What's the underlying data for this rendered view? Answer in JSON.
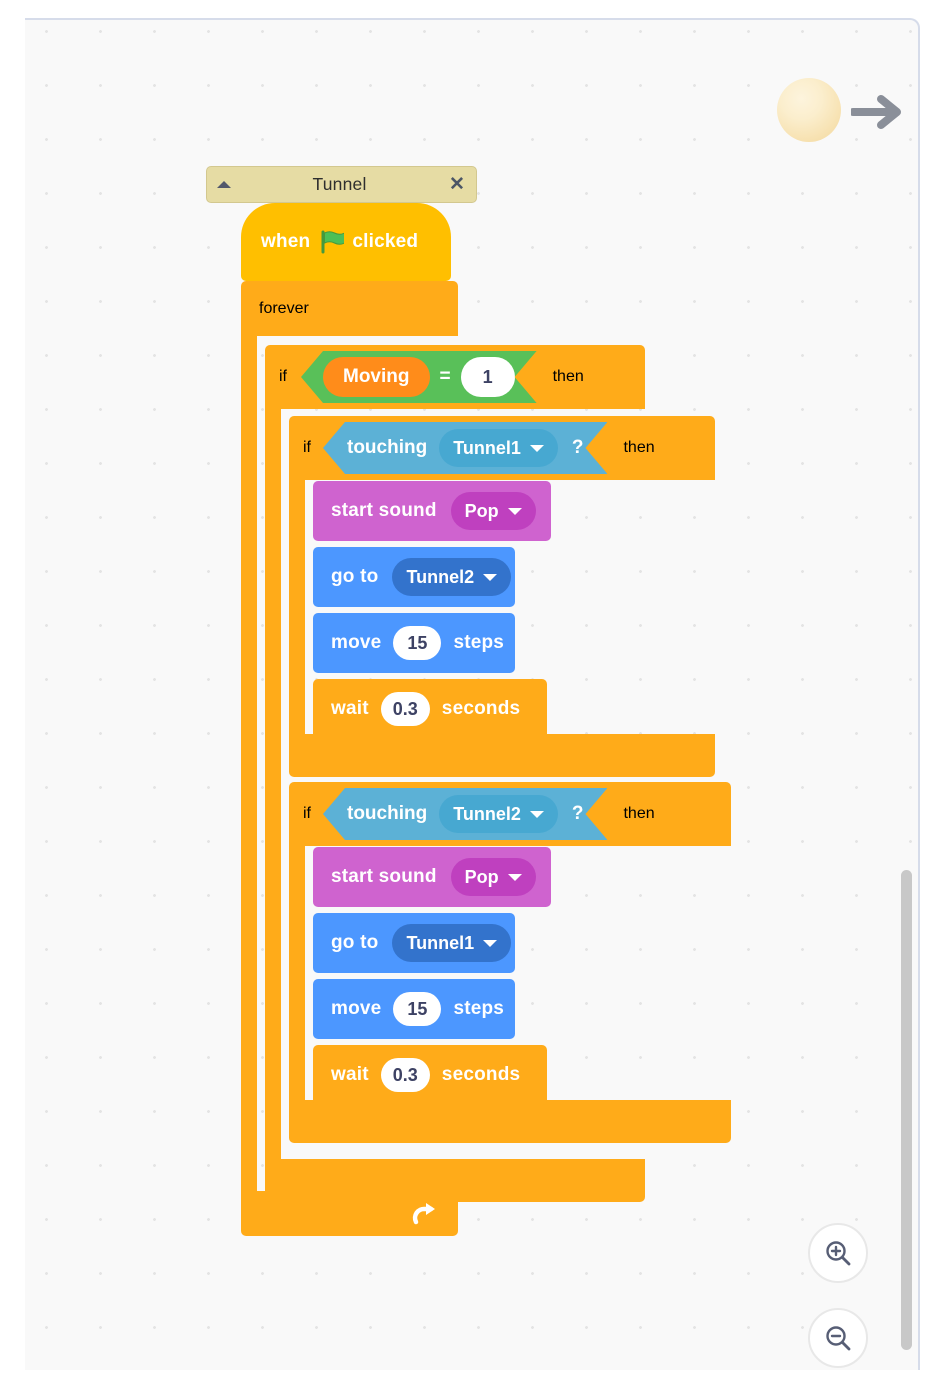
{
  "app": {
    "editor": "scratch-block-editor",
    "canvas_background": "#f9f9f9"
  },
  "sprite": {
    "name": "ball-sprite",
    "arrow": "direction-arrow"
  },
  "comment": {
    "title": "Tunnel",
    "collapse_icon": "triangle-up-icon",
    "close_icon": "close-icon",
    "color": "#e6dca4"
  },
  "script": {
    "hat": {
      "when": "when",
      "flag_icon": "green-flag-icon",
      "clicked": "clicked",
      "color": "#ffbf00"
    },
    "forever": {
      "label": "forever",
      "loop_icon": "loop-arrow-icon",
      "color": "#ffab19"
    },
    "if_outer": {
      "if": "if",
      "then": "then",
      "condition": {
        "type": "operator-equals",
        "left": "Moving",
        "operator": "=",
        "right": "1",
        "color": "#59c059",
        "variable_color": "#ff8c1a"
      }
    },
    "branch_one": {
      "if": "if",
      "then": "then",
      "condition": {
        "type": "sensing-touching",
        "label": "touching",
        "target": "Tunnel1",
        "question": "?",
        "color": "#5cb1d6"
      },
      "blocks": [
        {
          "type": "sound-start",
          "label": "start sound",
          "value": "Pop",
          "color": "#cf63cf"
        },
        {
          "type": "motion-goto",
          "label": "go to",
          "value": "Tunnel2",
          "color": "#4c97ff"
        },
        {
          "type": "motion-move",
          "label": "move",
          "value": "15",
          "suffix": "steps",
          "color": "#4c97ff"
        },
        {
          "type": "control-wait",
          "label": "wait",
          "value": "0.3",
          "suffix": "seconds",
          "color": "#ffab19"
        }
      ]
    },
    "branch_two": {
      "if": "if",
      "then": "then",
      "condition": {
        "type": "sensing-touching",
        "label": "touching",
        "target": "Tunnel2",
        "question": "?",
        "color": "#5cb1d6"
      },
      "blocks": [
        {
          "type": "sound-start",
          "label": "start sound",
          "value": "Pop",
          "color": "#cf63cf"
        },
        {
          "type": "motion-goto",
          "label": "go to",
          "value": "Tunnel1",
          "color": "#4c97ff"
        },
        {
          "type": "motion-move",
          "label": "move",
          "value": "15",
          "suffix": "steps",
          "color": "#4c97ff"
        },
        {
          "type": "control-wait",
          "label": "wait",
          "value": "0.3",
          "suffix": "seconds",
          "color": "#ffab19"
        }
      ]
    }
  },
  "controls": {
    "zoom_in": "zoom-in-icon",
    "zoom_out": "zoom-out-icon",
    "scrollbar": "vertical-scrollbar"
  }
}
